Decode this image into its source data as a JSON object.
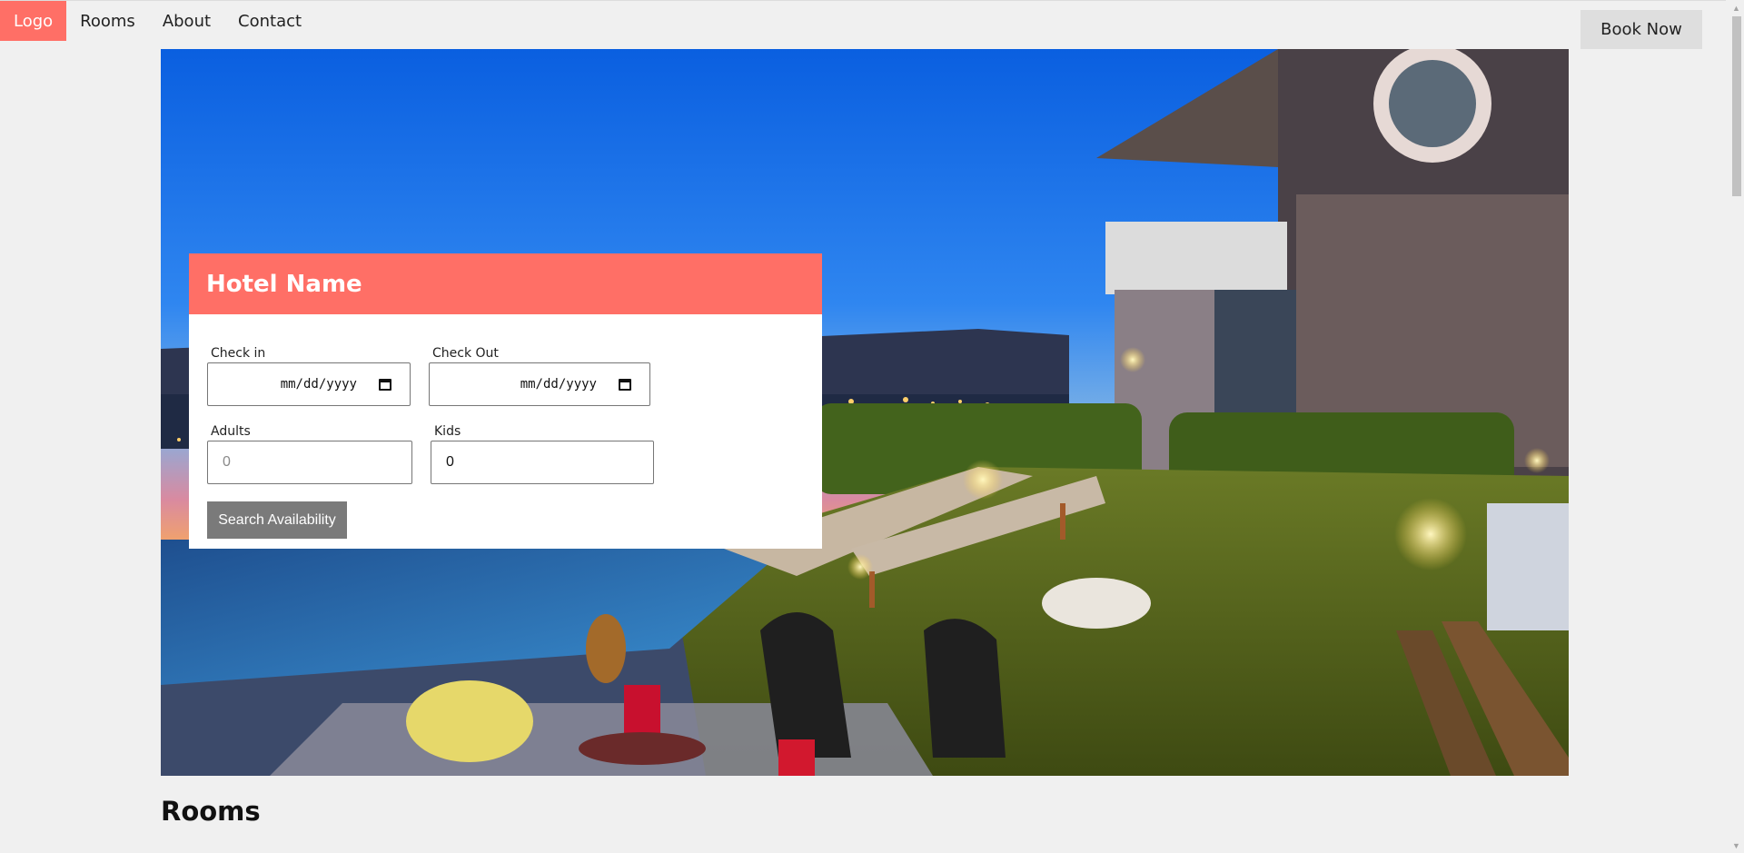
{
  "nav": {
    "logo": "Logo",
    "items": [
      {
        "label": "Rooms"
      },
      {
        "label": "About"
      },
      {
        "label": "Contact"
      }
    ],
    "book_now": "Book Now"
  },
  "booking": {
    "title": "Hotel Name",
    "check_in": {
      "label": "Check in",
      "value": "mm/dd/yyyy"
    },
    "check_out": {
      "label": "Check Out",
      "value": "mm/dd/yyyy"
    },
    "adults": {
      "label": "Adults",
      "placeholder": "0"
    },
    "kids": {
      "label": "Kids",
      "value": "0"
    },
    "search_button": "Search Availability"
  },
  "rooms_heading": "Rooms",
  "colors": {
    "accent": "#ff6f66",
    "button_gray": "#7a7a7a",
    "background": "#f0f0f0"
  },
  "icons": [
    "calendar-icon",
    "scroll-up-arrow-icon",
    "scroll-down-arrow-icon"
  ]
}
